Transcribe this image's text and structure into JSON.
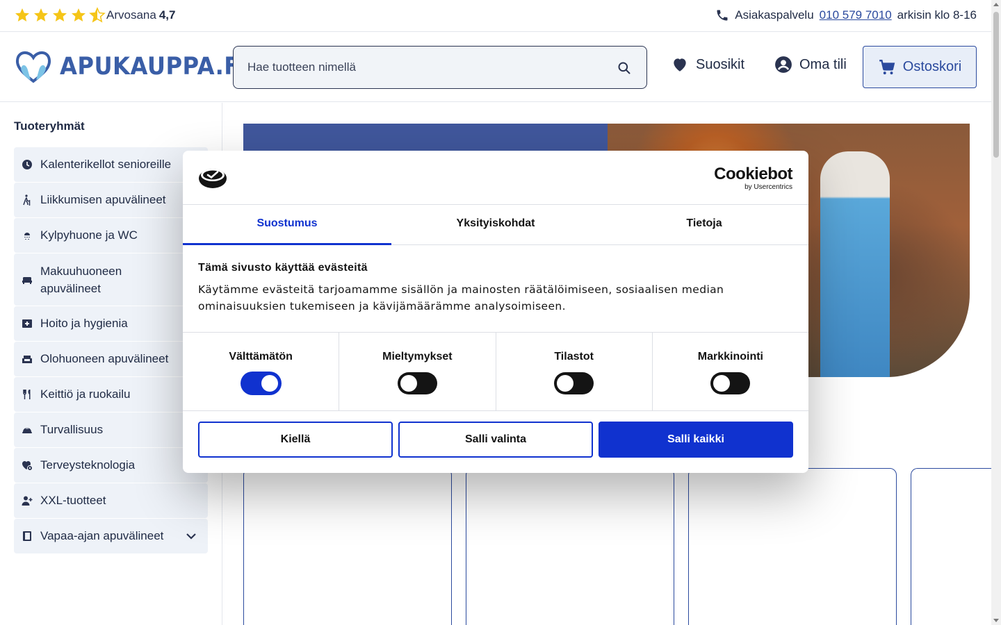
{
  "topbar": {
    "rating_label": "Arvosana",
    "rating_value": "4,7",
    "rating_stars": 4.5,
    "contact_label": "Asiakaspalvelu",
    "phone": "010 579 7010",
    "hours": "arkisin klo 8-16"
  },
  "header": {
    "logo_text": "APUKAUPPA.FI",
    "search_placeholder": "Hae tuotteen nimellä",
    "favorites": "Suosikit",
    "account": "Oma tili",
    "cart": "Ostoskori"
  },
  "sidebar": {
    "title": "Tuoteryhmät",
    "items": [
      {
        "label": "Kalenterikellot senioreille",
        "icon": "clock-icon"
      },
      {
        "label": "Liikkumisen apuvälineet",
        "icon": "walking-cane-icon"
      },
      {
        "label": "Kylpyhuone ja WC",
        "icon": "shower-icon"
      },
      {
        "label": "Makuuhuoneen apuvälineet",
        "icon": "bed-icon"
      },
      {
        "label": "Hoito ja hygienia",
        "icon": "first-aid-icon"
      },
      {
        "label": "Olohuoneen apuvälineet",
        "icon": "armchair-icon"
      },
      {
        "label": "Keittiö ja ruokailu",
        "icon": "utensils-icon"
      },
      {
        "label": "Turvallisuus",
        "icon": "helmet-icon"
      },
      {
        "label": "Terveysteknologia",
        "icon": "heart-tech-icon"
      },
      {
        "label": "XXL-tuotteet",
        "icon": "user-plus-icon"
      },
      {
        "label": "Vapaa-ajan apuvälineet",
        "icon": "book-icon"
      }
    ]
  },
  "cookie_dialog": {
    "brand": "Cookiebot",
    "brand_sub": "by Usercentrics",
    "tabs": [
      "Suostumus",
      "Yksityiskohdat",
      "Tietoja"
    ],
    "active_tab": "Suostumus",
    "title": "Tämä sivusto käyttää evästeitä",
    "text": "Käytämme evästeitä tarjoamamme sisällön ja mainosten räätälöimiseen, sosiaalisen median ominaisuuksien tukemiseen ja kävijämäärämme analysoimiseen.",
    "toggles": [
      {
        "label": "Välttämätön",
        "on": true
      },
      {
        "label": "Mieltymykset",
        "on": false
      },
      {
        "label": "Tilastot",
        "on": false
      },
      {
        "label": "Markkinointi",
        "on": false
      }
    ],
    "buttons": {
      "deny": "Kiellä",
      "allow_selection": "Salli valinta",
      "allow_all": "Salli kaikki"
    }
  },
  "colors": {
    "brand": "#3a5ea7",
    "accent": "#1032cf",
    "star": "#f5c518"
  }
}
